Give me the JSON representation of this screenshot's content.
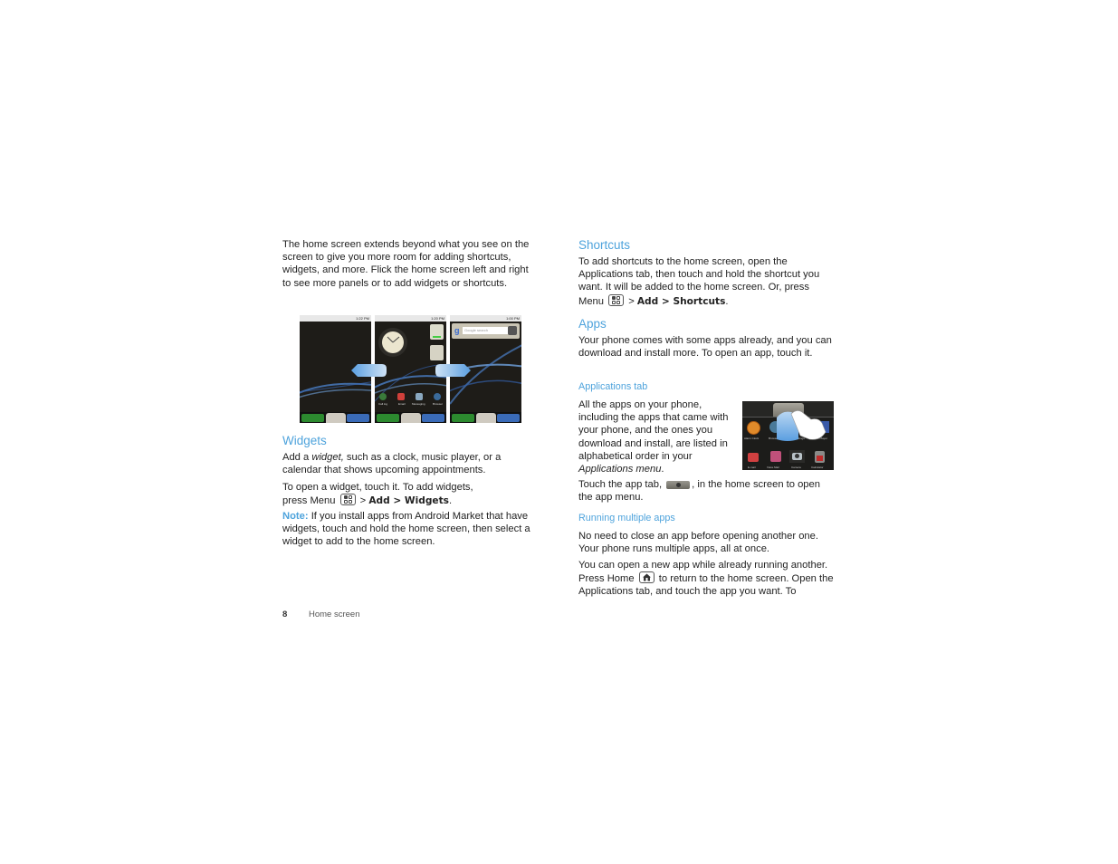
{
  "left_column": {
    "intro": "The home screen extends beyond what you see on the screen to give you more room for adding shortcuts, widgets, and more. Flick the home screen left and right to see more panels or to add widgets or shortcuts.",
    "screenshots": {
      "panel_left": {
        "time": "1:22 PM"
      },
      "panel_center": {
        "time": "1:20 PM",
        "apps": [
          "Call log",
          "Email",
          "Messaging",
          "Browser"
        ]
      },
      "panel_right": {
        "time": "1:00 PM",
        "search_placeholder": "Google search"
      }
    },
    "widgets": {
      "heading": "Widgets",
      "p1_pre": "Add a ",
      "p1_em": "widget,",
      "p1_post": " such as a clock, music player, or a calendar that shows upcoming appointments.",
      "p2_line1": "To open a widget, touch it. To add widgets,",
      "p2_pre": "press Menu",
      "p2_sep": " > ",
      "p2_bold": "Add > Widgets",
      "p2_end": ".",
      "note_label": "Note:",
      "note_text": " If you install apps from Android Market that have widgets, touch and hold the home screen, then select a widget to add to the home screen."
    }
  },
  "right_column": {
    "shortcuts": {
      "heading": "Shortcuts",
      "text_pre": "To add shortcuts to the home screen, open the Applications tab, then touch and hold the shortcut you want. It will be added to the home screen. Or, press Menu",
      "sep": " > ",
      "bold": "Add > Shortcuts",
      "end": "."
    },
    "apps": {
      "heading": "Apps",
      "text": "Your phone comes with some apps already, and you can download and install more. To open an app, touch it."
    },
    "applications_tab": {
      "heading": "Applications tab",
      "text_pre": "All the apps on your phone, including the apps that came with your phone, and the ones you download and install, are listed in alphabetical order in your ",
      "text_em": "Applications menu",
      "text_end": ".",
      "touch_pre": "Touch the app tab,",
      "touch_post": ", in the home screen to open the app menu.",
      "screenshot_apps": [
        "Alarm Clock",
        "Browser",
        "Settings",
        "Video Player",
        "E-mail",
        "Voice Mail",
        "Camera",
        "Calculator"
      ]
    },
    "running": {
      "heading": "Running multiple apps",
      "p1": "No need to close an app before opening another one. Your phone runs multiple apps, all at once.",
      "p2_pre": "You can open a new app while already running another. Press Home",
      "p2_post": " to return to the home screen. Open the Applications tab, and touch the app you want. To"
    }
  },
  "footer": {
    "page_number": "8",
    "section": "Home screen"
  }
}
